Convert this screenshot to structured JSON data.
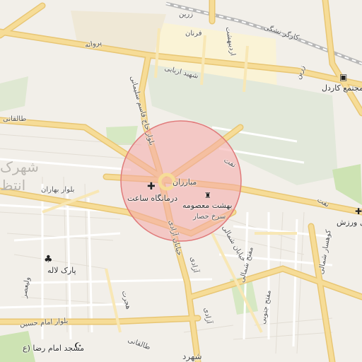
{
  "map": {
    "labels": {
      "zarrin_top": "زرین",
      "zarrin_right": "زرین",
      "farnan": "فرنان",
      "ordibehesht": "اردیبهشت",
      "parvaneh": "پروانه",
      "shahid_arbabi": "شهید اربابی",
      "kargar": "کارگر نشگی",
      "mojtama": "مجتمع کاردل",
      "taleghani": "طالقانی",
      "ghasem_soleimani": "بلوار حاج قاسم سلیمانی",
      "mobarezan": "مبارزان",
      "naft_top": "نفت",
      "naft_right": "نفت",
      "darmangah": "درمانگاه ساعت",
      "behesht": "بهشت معصومه",
      "sorkh_hesar": "سرخ حصار",
      "bahar": "بلوار بهاران",
      "shahrak": "شهرک",
      "ent": "انتظ",
      "pol_varzesh": "پل ورزش",
      "park_laleh": "پارک لاله",
      "valiasr": "ولیعصر",
      "imam_hossein": "بلوار امام حسین",
      "masjed_imam_reza": "مسجد امام رضا (ع",
      "azadi_mid": "آزادی",
      "azadi_left": "خیابان آزادی",
      "azadi_bottom": "آزادی",
      "hejrat": "هجرت",
      "shomali": "خیابان شمالی",
      "mofatteh": "مفتح شمالی",
      "mofatteh_jonubi": "مفتح جنوبی",
      "kuhsar": "کوهسار شمالی",
      "taleghani_bottom": "طالقانی",
      "shahrdari": "شهرد"
    },
    "colors": {
      "road": "#f6dc97",
      "road_edge": "#e8c674",
      "park": "#cde3b3",
      "industrial": "#faf3d6",
      "circle_fill": "#f4a7a7",
      "circle_stroke": "#e07a7a"
    },
    "icons": {
      "clinic": "plus-icon",
      "cemetery": "grave-icon",
      "park": "tree-icon",
      "mall": "shopping-bag-icon",
      "mosque": "mosque-icon"
    }
  }
}
